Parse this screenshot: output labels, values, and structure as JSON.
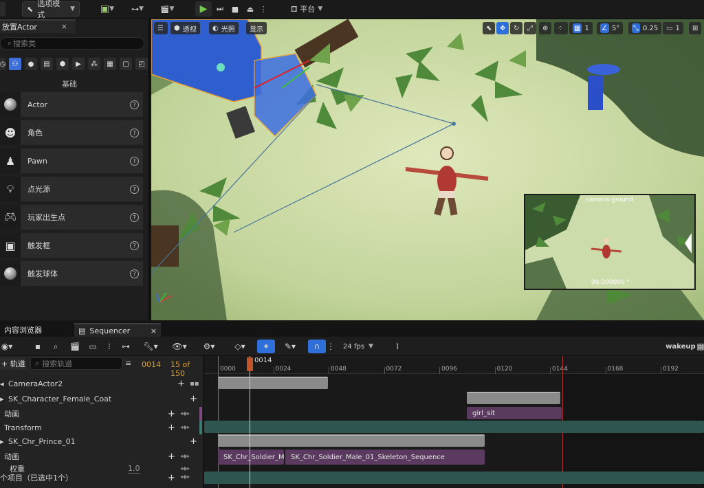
{
  "toolbar": {
    "mode_select": "选项模式",
    "platform": "平台"
  },
  "place_actor": {
    "tab_title": "放置Actor",
    "close": "×",
    "search_placeholder": "搜索类",
    "category_header": "基础",
    "items": [
      {
        "label": "Actor"
      },
      {
        "label": "角色"
      },
      {
        "label": "Pawn"
      },
      {
        "label": "点光源"
      },
      {
        "label": "玩家出生点"
      },
      {
        "label": "触发框"
      },
      {
        "label": "触发球体"
      }
    ],
    "help": "?"
  },
  "viewport": {
    "perspective": "透视",
    "lighting": "光照",
    "show": "显示",
    "grid_value": "1",
    "angle_value": "5°",
    "scale_value": "0.25",
    "camera_speed": "1",
    "preview_title": "camera-ground",
    "preview_value": "90.000000 °"
  },
  "bottom_tabs": {
    "content_browser": "内容浏览器",
    "sequencer": "Sequencer",
    "close": "×"
  },
  "sequencer": {
    "fps": "24 fps",
    "sequence_name": "wakeup",
    "add_track": "+ 轨道",
    "search_placeholder": "搜索轨道",
    "current_frame": "0014",
    "frame_count": "15 of 150",
    "playhead_label": "0014",
    "ruler_ticks": [
      "0000",
      "0024",
      "0048",
      "0072",
      "0096",
      "0120",
      "0144",
      "0168",
      "0192"
    ],
    "tracks": [
      {
        "name": "CameraActor2"
      },
      {
        "name": "SK_Character_Female_Coat"
      },
      {
        "name": "动画"
      },
      {
        "name": "Transform"
      },
      {
        "name": "SK_Chr_Prince_01"
      },
      {
        "name": "动画"
      },
      {
        "name": "权重"
      }
    ],
    "weight_value": "1.0",
    "status": "个项目（已选中1个）",
    "sections": {
      "girl_sit": "girl_sit",
      "soldier_short": "SK_Chr_Soldier_Ma",
      "soldier_long": "SK_Chr_Soldier_Male_01_Skeleton_Sequence"
    }
  },
  "colors": {
    "accent": "#2f6fd9",
    "ground": "#c5d6a0",
    "section_purple": "#5b3a60",
    "section_teal": "#2f5551",
    "playhead": "#c2542b"
  }
}
